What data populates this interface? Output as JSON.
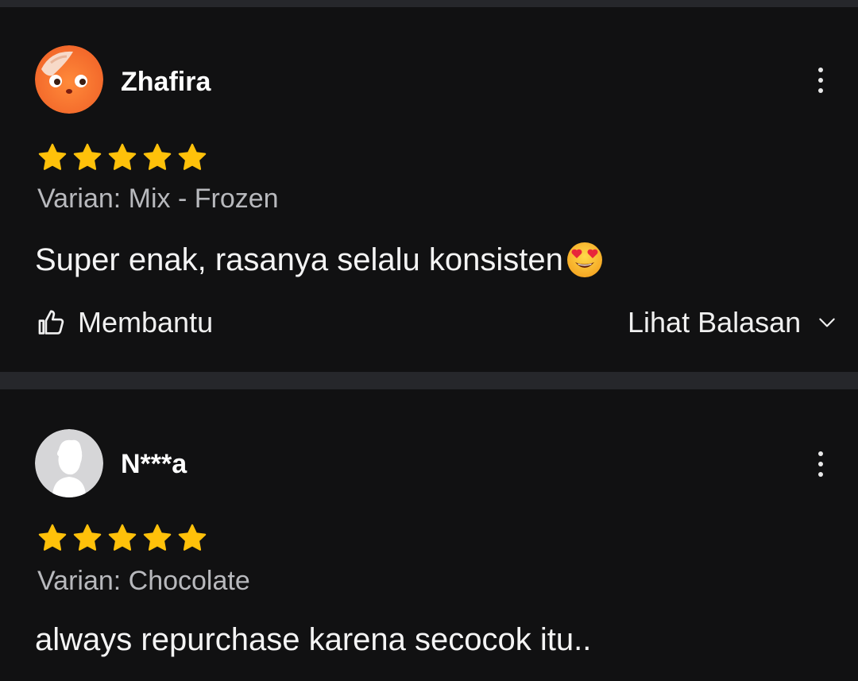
{
  "reviews": [
    {
      "username": "Zhafira",
      "avatar_icon": "cartoon-face-avatar",
      "rating": 5,
      "variant": "Varian: Mix - Frozen",
      "comment": "Super enak, rasanya selalu konsisten",
      "comment_emoji": "heart-eyes-emoji",
      "helpful_label": "Membantu",
      "replies_label": "Lihat Balasan",
      "more_icon": "more-vertical-icon"
    },
    {
      "username": "N***a",
      "avatar_icon": "default-user-avatar",
      "rating": 5,
      "variant": "Varian: Chocolate",
      "comment": "always repurchase karena secocok itu..",
      "more_icon": "more-vertical-icon"
    }
  ],
  "colors": {
    "background": "#111112",
    "divider": "#26272b",
    "star": "#ffc10a",
    "muted_text": "#b8b9bd"
  }
}
